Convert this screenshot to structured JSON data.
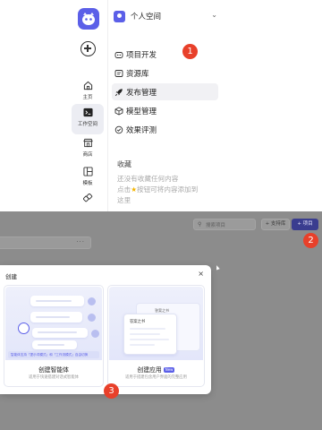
{
  "sidebar": {
    "rail_items": [
      {
        "label": "主页",
        "icon": "home-icon"
      },
      {
        "label": "工作空间",
        "icon": "terminal-icon"
      },
      {
        "label": "商店",
        "icon": "store-icon"
      },
      {
        "label": "模板",
        "icon": "template-icon"
      }
    ],
    "workspace": {
      "title": "个人空间"
    },
    "nav_items": [
      {
        "label": "项目开发",
        "icon": "robot-icon"
      },
      {
        "label": "资源库",
        "icon": "library-icon"
      },
      {
        "label": "发布管理",
        "icon": "rocket-icon"
      },
      {
        "label": "模型管理",
        "icon": "cube-icon"
      },
      {
        "label": "效果评测",
        "icon": "evaluation-icon"
      }
    ],
    "favorites": {
      "title": "收藏",
      "line1": "还没有收藏任何内容",
      "line2_pre": "点击",
      "line2_post": "按钮可将内容添加到",
      "line3": "这里"
    }
  },
  "workspace_page": {
    "search_placeholder": "搜索项目",
    "space_button": "+ 支持库",
    "create_button": "+ 项目",
    "card_menu": "···"
  },
  "modal": {
    "title": "创建",
    "close": "×",
    "options": [
      {
        "name": "创建智能体",
        "desc": "适用于快速搭建对话式智能体",
        "hint": "智能体支持「提示词模式」和「工作流模式」自由切换"
      },
      {
        "name": "创建应用",
        "tag": "New",
        "desc": "适用于搭建包含用户界面的完整应用",
        "window_title": "答案之书",
        "window_back_title": "答案之书"
      }
    ]
  },
  "step_badges": [
    "1",
    "2",
    "3"
  ],
  "colors": {
    "accent": "#5b5fe8",
    "badge": "#e8402a",
    "overlay": "#8c8c8c",
    "create_button_dimmed": "#3a3d8f"
  }
}
